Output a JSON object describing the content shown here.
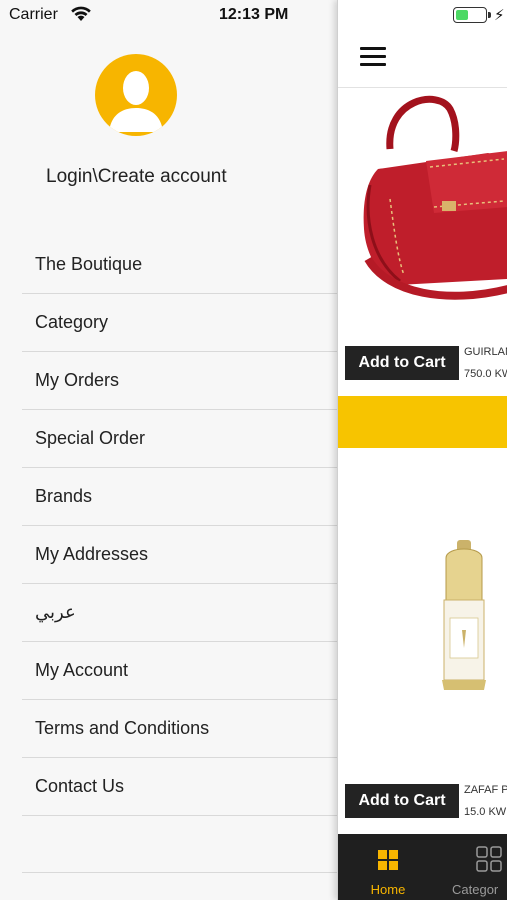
{
  "status_bar": {
    "carrier": "Carrier",
    "time": "12:13 PM",
    "battery_level": 0.45
  },
  "drawer": {
    "login_label": "Login\\Create account",
    "menu_items": [
      {
        "label": "The Boutique"
      },
      {
        "label": "Category"
      },
      {
        "label": "My Orders"
      },
      {
        "label": "Special Order"
      },
      {
        "label": "Brands"
      },
      {
        "label": "My Addresses"
      },
      {
        "label": "عربي"
      },
      {
        "label": "My Account"
      },
      {
        "label": "Terms and Conditions"
      },
      {
        "label": "Contact Us"
      }
    ]
  },
  "products": [
    {
      "name": "GUIRLAN",
      "price": "750.0 KW",
      "cart_label": "Add to Cart"
    },
    {
      "name": "ZAFAF P",
      "price": "15.0 KW",
      "cart_label": "Add to Cart"
    }
  ],
  "tabs": [
    {
      "label": "Home",
      "active": true
    },
    {
      "label": "Categor",
      "active": false
    }
  ],
  "colors": {
    "accent": "#F7B500",
    "tab_active": "#F7B500",
    "tab_inactive": "#9A9A9A",
    "button_bg": "#232323"
  }
}
